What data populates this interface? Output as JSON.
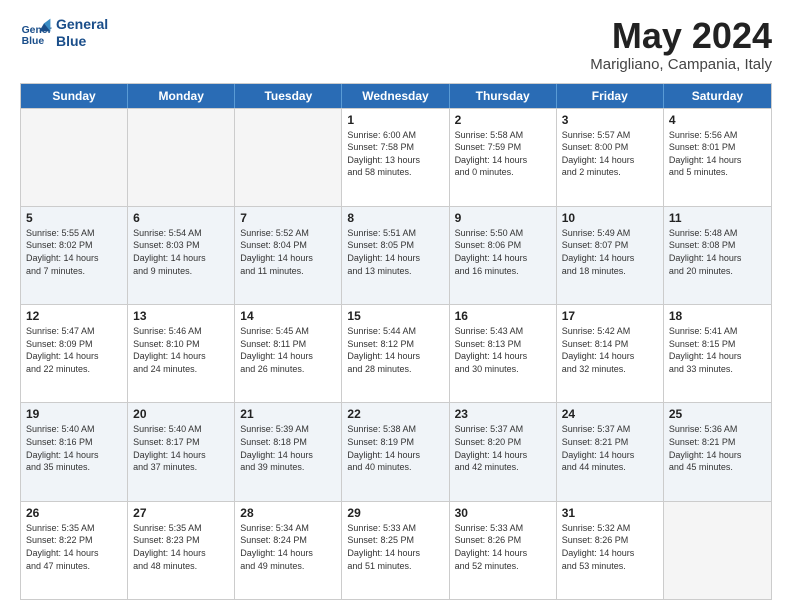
{
  "logo": {
    "line1": "General",
    "line2": "Blue"
  },
  "title": "May 2024",
  "subtitle": "Marigliano, Campania, Italy",
  "days": [
    "Sunday",
    "Monday",
    "Tuesday",
    "Wednesday",
    "Thursday",
    "Friday",
    "Saturday"
  ],
  "rows": [
    [
      {
        "day": "",
        "info": ""
      },
      {
        "day": "",
        "info": ""
      },
      {
        "day": "",
        "info": ""
      },
      {
        "day": "1",
        "info": "Sunrise: 6:00 AM\nSunset: 7:58 PM\nDaylight: 13 hours\nand 58 minutes."
      },
      {
        "day": "2",
        "info": "Sunrise: 5:58 AM\nSunset: 7:59 PM\nDaylight: 14 hours\nand 0 minutes."
      },
      {
        "day": "3",
        "info": "Sunrise: 5:57 AM\nSunset: 8:00 PM\nDaylight: 14 hours\nand 2 minutes."
      },
      {
        "day": "4",
        "info": "Sunrise: 5:56 AM\nSunset: 8:01 PM\nDaylight: 14 hours\nand 5 minutes."
      }
    ],
    [
      {
        "day": "5",
        "info": "Sunrise: 5:55 AM\nSunset: 8:02 PM\nDaylight: 14 hours\nand 7 minutes."
      },
      {
        "day": "6",
        "info": "Sunrise: 5:54 AM\nSunset: 8:03 PM\nDaylight: 14 hours\nand 9 minutes."
      },
      {
        "day": "7",
        "info": "Sunrise: 5:52 AM\nSunset: 8:04 PM\nDaylight: 14 hours\nand 11 minutes."
      },
      {
        "day": "8",
        "info": "Sunrise: 5:51 AM\nSunset: 8:05 PM\nDaylight: 14 hours\nand 13 minutes."
      },
      {
        "day": "9",
        "info": "Sunrise: 5:50 AM\nSunset: 8:06 PM\nDaylight: 14 hours\nand 16 minutes."
      },
      {
        "day": "10",
        "info": "Sunrise: 5:49 AM\nSunset: 8:07 PM\nDaylight: 14 hours\nand 18 minutes."
      },
      {
        "day": "11",
        "info": "Sunrise: 5:48 AM\nSunset: 8:08 PM\nDaylight: 14 hours\nand 20 minutes."
      }
    ],
    [
      {
        "day": "12",
        "info": "Sunrise: 5:47 AM\nSunset: 8:09 PM\nDaylight: 14 hours\nand 22 minutes."
      },
      {
        "day": "13",
        "info": "Sunrise: 5:46 AM\nSunset: 8:10 PM\nDaylight: 14 hours\nand 24 minutes."
      },
      {
        "day": "14",
        "info": "Sunrise: 5:45 AM\nSunset: 8:11 PM\nDaylight: 14 hours\nand 26 minutes."
      },
      {
        "day": "15",
        "info": "Sunrise: 5:44 AM\nSunset: 8:12 PM\nDaylight: 14 hours\nand 28 minutes."
      },
      {
        "day": "16",
        "info": "Sunrise: 5:43 AM\nSunset: 8:13 PM\nDaylight: 14 hours\nand 30 minutes."
      },
      {
        "day": "17",
        "info": "Sunrise: 5:42 AM\nSunset: 8:14 PM\nDaylight: 14 hours\nand 32 minutes."
      },
      {
        "day": "18",
        "info": "Sunrise: 5:41 AM\nSunset: 8:15 PM\nDaylight: 14 hours\nand 33 minutes."
      }
    ],
    [
      {
        "day": "19",
        "info": "Sunrise: 5:40 AM\nSunset: 8:16 PM\nDaylight: 14 hours\nand 35 minutes."
      },
      {
        "day": "20",
        "info": "Sunrise: 5:40 AM\nSunset: 8:17 PM\nDaylight: 14 hours\nand 37 minutes."
      },
      {
        "day": "21",
        "info": "Sunrise: 5:39 AM\nSunset: 8:18 PM\nDaylight: 14 hours\nand 39 minutes."
      },
      {
        "day": "22",
        "info": "Sunrise: 5:38 AM\nSunset: 8:19 PM\nDaylight: 14 hours\nand 40 minutes."
      },
      {
        "day": "23",
        "info": "Sunrise: 5:37 AM\nSunset: 8:20 PM\nDaylight: 14 hours\nand 42 minutes."
      },
      {
        "day": "24",
        "info": "Sunrise: 5:37 AM\nSunset: 8:21 PM\nDaylight: 14 hours\nand 44 minutes."
      },
      {
        "day": "25",
        "info": "Sunrise: 5:36 AM\nSunset: 8:21 PM\nDaylight: 14 hours\nand 45 minutes."
      }
    ],
    [
      {
        "day": "26",
        "info": "Sunrise: 5:35 AM\nSunset: 8:22 PM\nDaylight: 14 hours\nand 47 minutes."
      },
      {
        "day": "27",
        "info": "Sunrise: 5:35 AM\nSunset: 8:23 PM\nDaylight: 14 hours\nand 48 minutes."
      },
      {
        "day": "28",
        "info": "Sunrise: 5:34 AM\nSunset: 8:24 PM\nDaylight: 14 hours\nand 49 minutes."
      },
      {
        "day": "29",
        "info": "Sunrise: 5:33 AM\nSunset: 8:25 PM\nDaylight: 14 hours\nand 51 minutes."
      },
      {
        "day": "30",
        "info": "Sunrise: 5:33 AM\nSunset: 8:26 PM\nDaylight: 14 hours\nand 52 minutes."
      },
      {
        "day": "31",
        "info": "Sunrise: 5:32 AM\nSunset: 8:26 PM\nDaylight: 14 hours\nand 53 minutes."
      },
      {
        "day": "",
        "info": ""
      }
    ]
  ]
}
